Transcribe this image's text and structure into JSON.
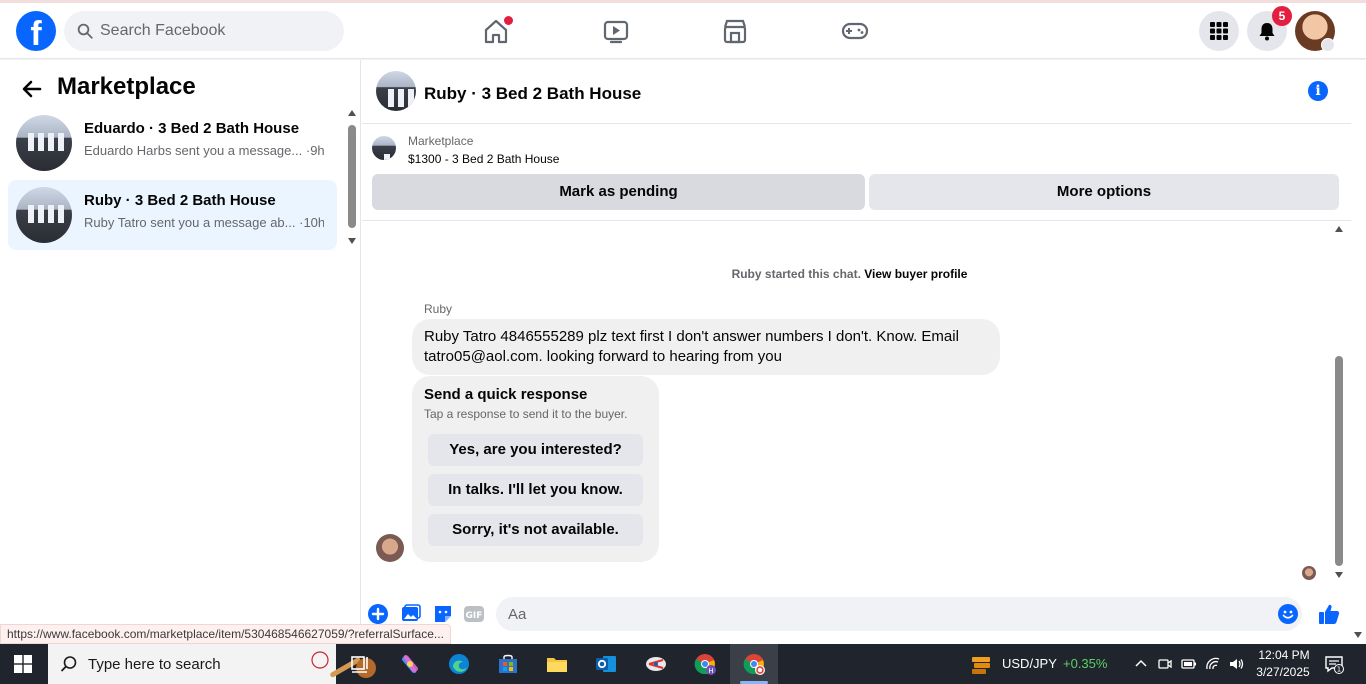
{
  "topbar": {
    "logo_letter": "f",
    "search_placeholder": "Search Facebook",
    "notification_count": "5",
    "accent": "#0866ff",
    "badge_color": "#e41e3f"
  },
  "sidebar": {
    "title": "Marketplace",
    "conversations": [
      {
        "title": "Eduardo · 3 Bed 2 Bath House",
        "preview": "Eduardo Harbs sent you a message...",
        "time": "·9h",
        "active": false
      },
      {
        "title": "Ruby · 3 Bed 2 Bath House",
        "preview": "Ruby Tatro sent you a message ab...",
        "time": "·10h",
        "active": true
      }
    ]
  },
  "chat": {
    "title": "Ruby · 3 Bed 2 Bath House",
    "listing_label": "Marketplace",
    "listing_price": "$1300 - 3 Bed 2 Bath House",
    "mark_pending_label": "Mark as pending",
    "more_options_label": "More options",
    "system_message": "Ruby started this chat.",
    "system_link": "View buyer profile",
    "sender_name": "Ruby",
    "message_text": "Ruby Tatro 4846555289 plz text first I don't answer numbers I don't. Know. Email tatro05@aol.com. looking forward to hearing from you",
    "quick_title": "Send a quick response",
    "quick_subtitle": "Tap a response to send it to the buyer.",
    "quick_responses": [
      "Yes, are you interested?",
      "In talks. I'll let you know.",
      "Sorry, it's not available."
    ],
    "composer_placeholder": "Aa"
  },
  "status_url": "https://www.facebook.com/marketplace/item/530468546627059/?referralSurface...",
  "taskbar": {
    "search_label": "Type here to search",
    "ticker_name": "USD/JPY",
    "ticker_change": "+0.35%",
    "time": "12:04 PM",
    "date": "3/27/2025",
    "notification_badge": "1"
  }
}
